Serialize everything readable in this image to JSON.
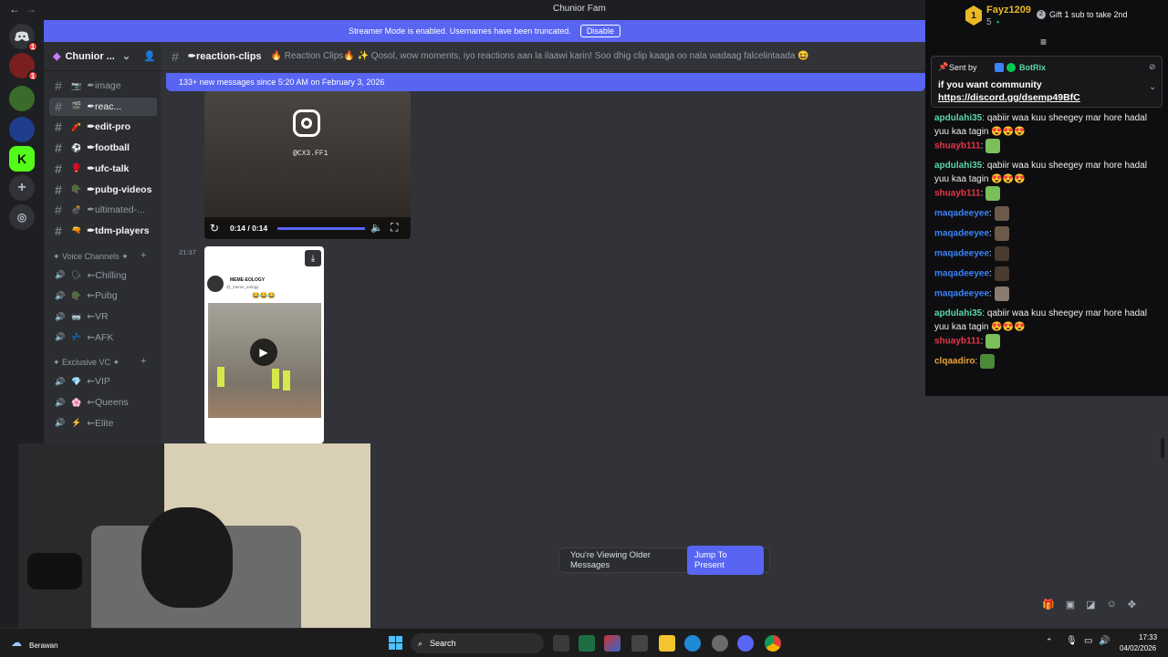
{
  "window": {
    "title": "Chunior Fam"
  },
  "banner": {
    "text": "Streamer Mode is enabled. Usernames have been truncated.",
    "button": "Disable"
  },
  "server": {
    "name": "Chunior ..."
  },
  "channels": [
    {
      "name": "✒image",
      "icon": "📷"
    },
    {
      "name": "✒reac...",
      "icon": "🎬",
      "active": true
    },
    {
      "name": "✒edit-pro",
      "icon": "🧨",
      "bright": true
    },
    {
      "name": "✒football",
      "icon": "⚽",
      "bright": true
    },
    {
      "name": "✒ufc-talk",
      "icon": "🥊",
      "bright": true
    },
    {
      "name": "✒pubg-videos",
      "icon": "🪖",
      "bright": true
    },
    {
      "name": "✒ultimated-...",
      "icon": "💣"
    },
    {
      "name": "✒tdm-players",
      "icon": "🔫",
      "bright": true
    }
  ],
  "voice_category": "✦ Voice Channels ✦",
  "voice_channels": [
    {
      "name": "⇜Chilling",
      "icon": "🗣"
    },
    {
      "name": "⇜Pubg",
      "icon": "🪖"
    },
    {
      "name": "⇜VR",
      "icon": "🥽"
    },
    {
      "name": "⇜AFK",
      "icon": "💤"
    }
  ],
  "exclusive_category": "✦ Exclusive VC ✦",
  "exclusive_channels": [
    {
      "name": "⇜VIP",
      "icon": "💎"
    },
    {
      "name": "⇜Queens",
      "icon": "🌸"
    },
    {
      "name": "⇜Elite",
      "icon": "⚡"
    }
  ],
  "header": {
    "channel": "✒reaction-clips",
    "topic": "🔥 Reaction Clips🔥 ✨ Qosol, wow moments, iyo reactions aan la ilaawi karin! Soo dhig clip kaaga oo nala wadaag falcelintaada 😆"
  },
  "new_messages": "133+ new messages since 5:20 AM on February 3, 2026",
  "video1": {
    "handle": "@CX3.FF1",
    "time": "0:14 / 0:14"
  },
  "message2": {
    "timestamp": "21:37",
    "account": "MEME-EOLOGY",
    "handle": "@_meme_eology",
    "emojis": "😂😂😂"
  },
  "jump": {
    "text": "You're Viewing Older Messages",
    "button": "Jump To Present"
  },
  "chat": {
    "user": "Fayz1209",
    "sub_count": "5",
    "gift_text": "Gift 1 sub to take 2nd",
    "pinned_prefix": "Sent by",
    "pinned_bot": "BotRix",
    "pinned_text": "if you want community",
    "pinned_link": "https://discord.gg/dsemp49BfC",
    "messages": [
      {
        "user": "apdulahi35",
        "color": "#5cd6a6",
        "text": "qabiir waa kuu sheegey mar hore hadal yuu kaa tagin 😍😍😍"
      },
      {
        "user": "shuayb111",
        "color": "#e8354a",
        "text": "",
        "emote": "#7bbf5a"
      },
      {
        "user": "apdulahi35",
        "color": "#5cd6a6",
        "text": "qabiir waa kuu sheegey mar hore hadal yuu kaa tagin 😍😍😍"
      },
      {
        "user": "shuayb111",
        "color": "#e8354a",
        "text": "",
        "emote": "#7bbf5a"
      },
      {
        "user": "maqadeeyee",
        "color": "#3b82f6",
        "text": "",
        "emote": "#6b5a4a"
      },
      {
        "user": "maqadeeyee",
        "color": "#3b82f6",
        "text": "",
        "emote": "#6b5a4a"
      },
      {
        "user": "maqadeeyee",
        "color": "#3b82f6",
        "text": "",
        "emote": "#4a3a30"
      },
      {
        "user": "maqadeeyee",
        "color": "#3b82f6",
        "text": "",
        "emote": "#4a3a30"
      },
      {
        "user": "maqadeeyee",
        "color": "#3b82f6",
        "text": "",
        "emote": "#8a7a70"
      },
      {
        "user": "apdulahi35",
        "color": "#5cd6a6",
        "text": "qabiir waa kuu sheegey mar hore hadal yuu kaa tagin 😍😍😍"
      },
      {
        "user": "shuayb111",
        "color": "#e8354a",
        "text": "",
        "emote": "#7bbf5a"
      },
      {
        "user": "clqaadiro",
        "color": "#e8a33d",
        "text": "",
        "emote": "#4c8a3a"
      }
    ]
  },
  "taskbar": {
    "weather": "Berawan",
    "search": "Search",
    "time": "17:33",
    "date": "04/02/2026"
  }
}
